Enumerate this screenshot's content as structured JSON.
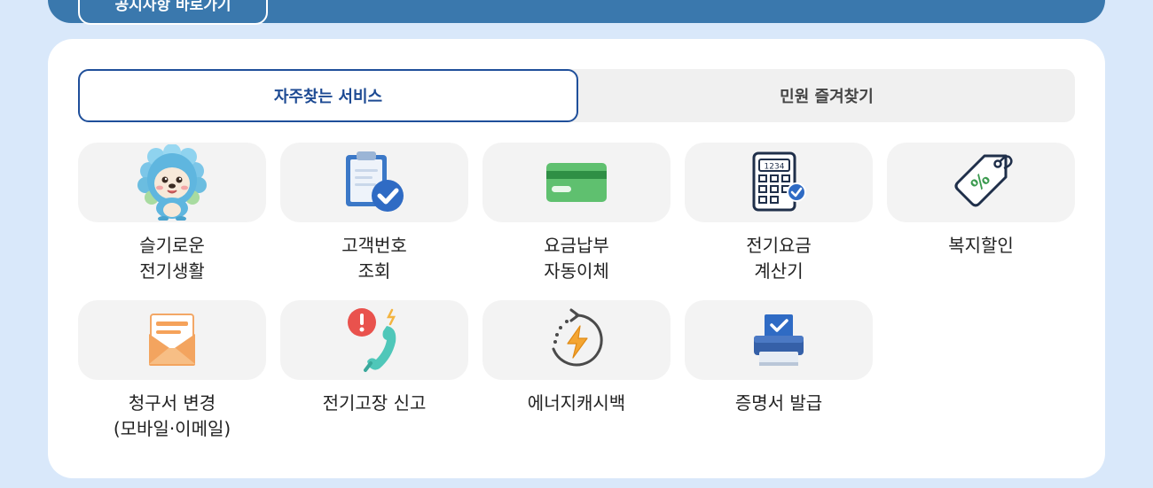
{
  "header": {
    "notice_button_label": "공지사항 바로가기"
  },
  "tabs": [
    {
      "label": "자주찾는 서비스",
      "active": true
    },
    {
      "label": "민원 즐겨찾기",
      "active": false
    }
  ],
  "services": [
    {
      "label": "슬기로운\n전기생활",
      "icon": "hedgehog-mascot-icon"
    },
    {
      "label": "고객번호\n조회",
      "icon": "clipboard-check-icon"
    },
    {
      "label": "요금납부\n자동이체",
      "icon": "credit-card-icon"
    },
    {
      "label": "전기요금\n계산기",
      "icon": "calculator-icon"
    },
    {
      "label": "복지할인",
      "icon": "discount-tag-icon"
    },
    {
      "label": "청구서 변경\n(모바일·이메일)",
      "icon": "envelope-icon"
    },
    {
      "label": "전기고장 신고",
      "icon": "phone-alert-icon"
    },
    {
      "label": "에너지캐시백",
      "icon": "energy-cashback-icon"
    },
    {
      "label": "증명서 발급",
      "icon": "printer-icon"
    }
  ],
  "icon_text": {
    "calculator_display": "1234",
    "discount_symbol": "%"
  },
  "colors": {
    "accent": "#1d4a93",
    "banner": "#3a78ad",
    "background": "#d9e8fa"
  }
}
